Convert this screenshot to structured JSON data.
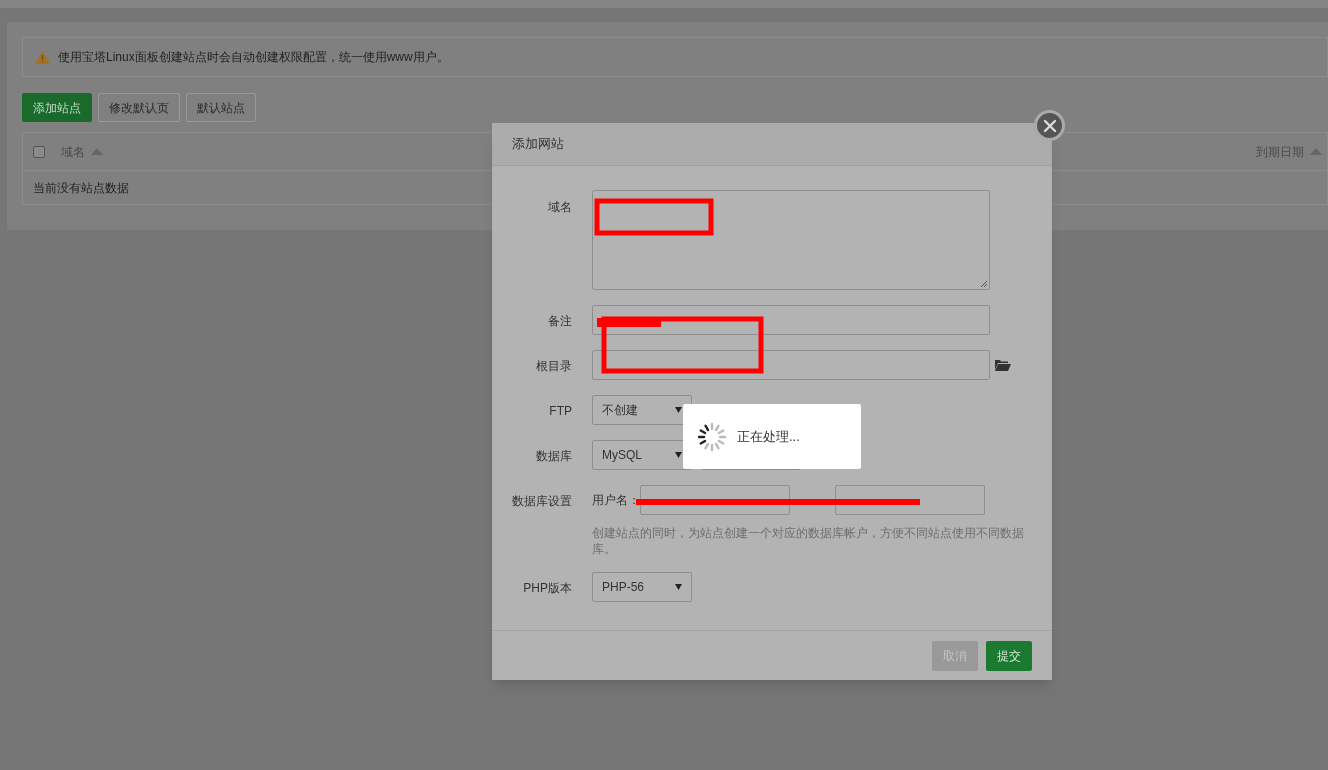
{
  "notice": "使用宝塔Linux面板创建站点时会自动创建权限配置，统一使用www用户。",
  "toolbar_buttons": [
    {
      "label": "添加站点",
      "kind": "primary"
    },
    {
      "label": "修改默认页",
      "kind": "default"
    },
    {
      "label": "默认站点",
      "kind": "default"
    }
  ],
  "table": {
    "select_all": {
      "checked": false
    },
    "columns": [
      "域名",
      "到期日期"
    ],
    "empty_message": "当前没有站点数据"
  },
  "dialog": {
    "title": "添加网站",
    "fields": [
      {
        "kind": "textarea",
        "label": "域名"
      },
      {
        "kind": "input",
        "label": "备注"
      },
      {
        "kind": "folder",
        "label": "根目录"
      },
      {
        "kind": "select",
        "label": "FTP",
        "value": "不创建"
      },
      {
        "kind": "select2",
        "label": "数据库",
        "value": "MySQL"
      },
      {
        "kind": "dbuser",
        "label": "数据库设置",
        "user_label": "用户名：",
        "help": "创建站点的同时，为站点创建一个对应的数据库帐户，方便不同站点使用不同数据库。"
      },
      {
        "kind": "select",
        "label": "PHP版本",
        "value": "PHP-56"
      }
    ],
    "buttons": [
      {
        "label": "取消",
        "kind": "cancel"
      },
      {
        "label": "提交",
        "kind": "submit"
      }
    ]
  },
  "loading": {
    "text": "正在处理..."
  }
}
